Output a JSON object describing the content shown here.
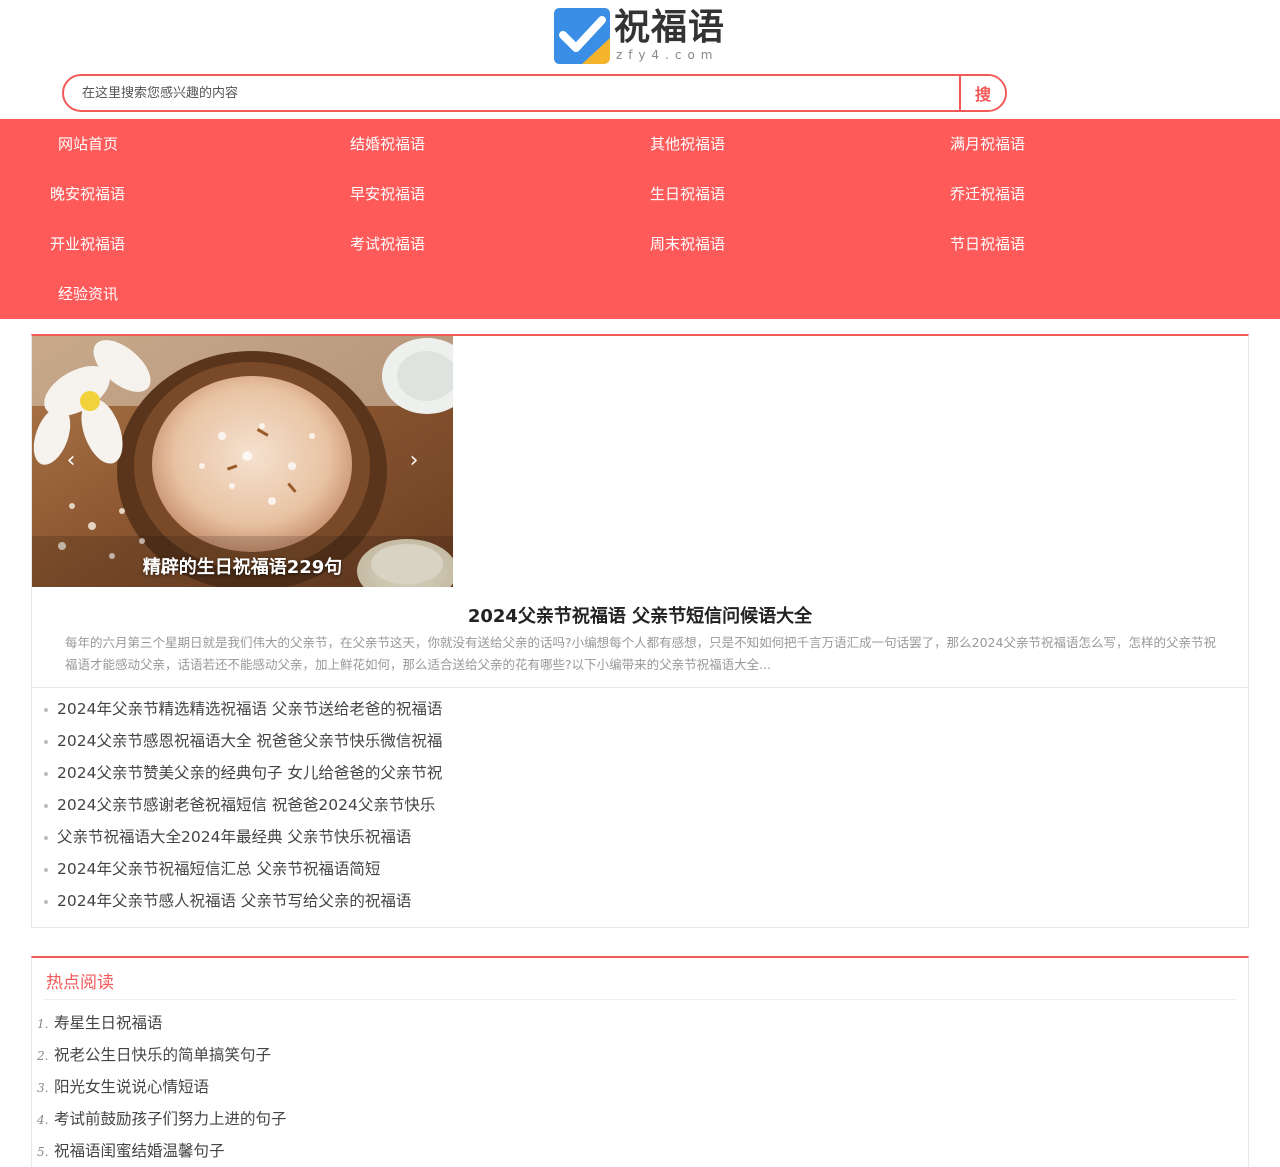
{
  "header": {
    "logo_title": "祝福语",
    "logo_sub": "zfy4.com",
    "search_placeholder": "在这里搜索您感兴趣的内容",
    "search_button": "搜"
  },
  "nav": {
    "items": [
      "网站首页",
      "结婚祝福语",
      "其他祝福语",
      "满月祝福语",
      "晚安祝福语",
      "早安祝福语",
      "生日祝福语",
      "乔迁祝福语",
      "开业祝福语",
      "考试祝福语",
      "周末祝福语",
      "节日祝福语",
      "经验资讯"
    ]
  },
  "feature": {
    "slide_caption": "精辟的生日祝福语229句",
    "title": "2024父亲节祝福语 父亲节短信问候语大全",
    "description": "每年的六月第三个星期日就是我们伟大的父亲节，在父亲节这天，你就没有送给父亲的话吗?小编想每个人都有感想，只是不知如何把千言万语汇成一句话罢了，那么2024父亲节祝福语怎么写，怎样的父亲节祝福语才能感动父亲，话语若还不能感动父亲，加上鲜花如何，那么适合送给父亲的花有哪些?以下小编带来的父亲节祝福语大全...",
    "links": [
      "2024年父亲节精选精选祝福语 父亲节送给老爸的祝福语",
      "2024父亲节感恩祝福语大全 祝爸爸父亲节快乐微信祝福",
      "2024父亲节赞美父亲的经典句子 女儿给爸爸的父亲节祝",
      "2024父亲节感谢老爸祝福短信 祝爸爸2024父亲节快乐",
      "父亲节祝福语大全2024年最经典 父亲节快乐祝福语",
      "2024年父亲节祝福短信汇总 父亲节祝福语简短",
      "2024年父亲节感人祝福语 父亲节写给父亲的祝福语"
    ]
  },
  "hot": {
    "title": "热点阅读",
    "items": [
      {
        "num": "1.",
        "text": "寿星生日祝福语"
      },
      {
        "num": "2.",
        "text": "祝老公生日快乐的简单搞笑句子"
      },
      {
        "num": "3.",
        "text": "阳光女生说说心情短语"
      },
      {
        "num": "4.",
        "text": "考试前鼓励孩子们努力上进的句子"
      },
      {
        "num": "5.",
        "text": "祝福语闺蜜结婚温馨句子"
      }
    ]
  },
  "icons": {
    "prev": "chevron-left-icon",
    "next": "chevron-right-icon"
  },
  "colors": {
    "accent": "#fe5a5a",
    "border_accent": "#f25a5a",
    "logo_blue": "#3a8ee6",
    "logo_yellow": "#f6b42c"
  }
}
